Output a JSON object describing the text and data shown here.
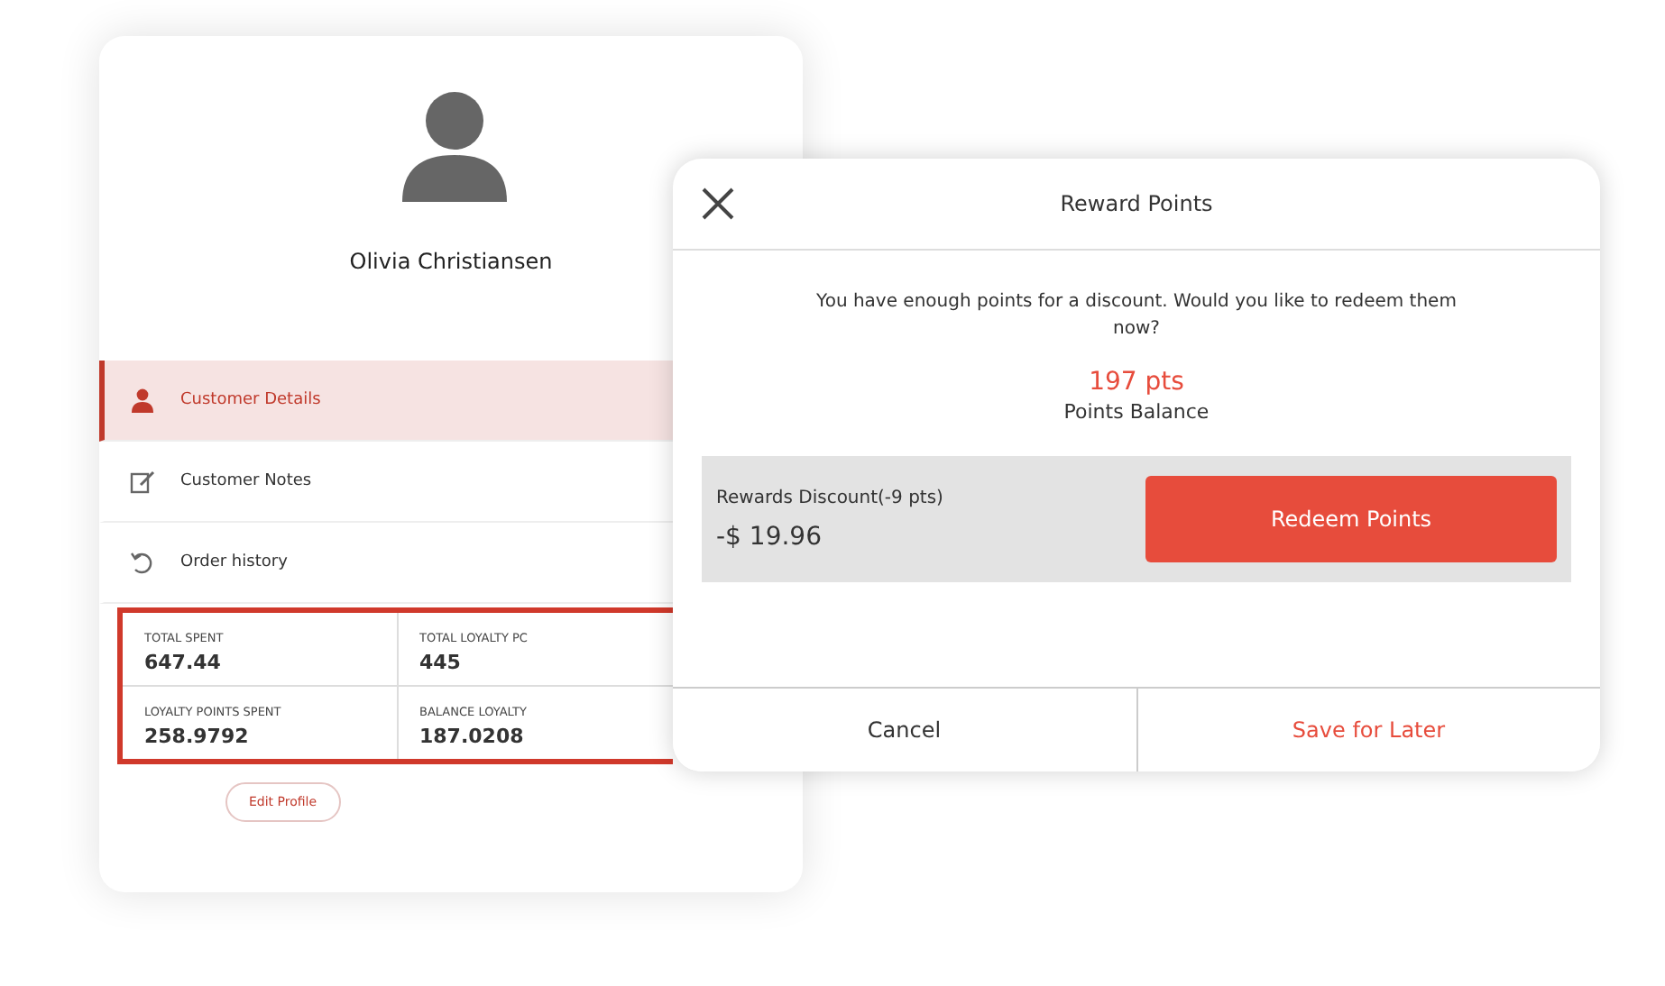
{
  "profile": {
    "name": "Olivia Christiansen",
    "menu": [
      {
        "label": "Customer Details",
        "selected": true
      },
      {
        "label": "Customer Notes",
        "selected": false
      },
      {
        "label": "Order history",
        "selected": false
      }
    ],
    "stats": [
      {
        "label": "TOTAL SPENT",
        "value": "647.44"
      },
      {
        "label": "TOTAL LOYALTY PC",
        "value": "445"
      },
      {
        "label": "LOYALTY POINTS SPENT",
        "value": "258.9792"
      },
      {
        "label": "BALANCE LOYALTY",
        "value": "187.0208"
      }
    ],
    "edit_button": "Edit Profile"
  },
  "dialog": {
    "title": "Reward Points",
    "message": "You have enough points for a discount. Would you like to redeem them now?",
    "points": "197 pts",
    "points_label": "Points Balance",
    "discount_label": "Rewards Discount(-9 pts)",
    "discount_value": "-$ 19.96",
    "redeem_button": "Redeem Points",
    "buttons": [
      {
        "label": "Cancel",
        "kind": "neutral"
      },
      {
        "label": "Save for Later",
        "kind": "accent"
      }
    ]
  }
}
